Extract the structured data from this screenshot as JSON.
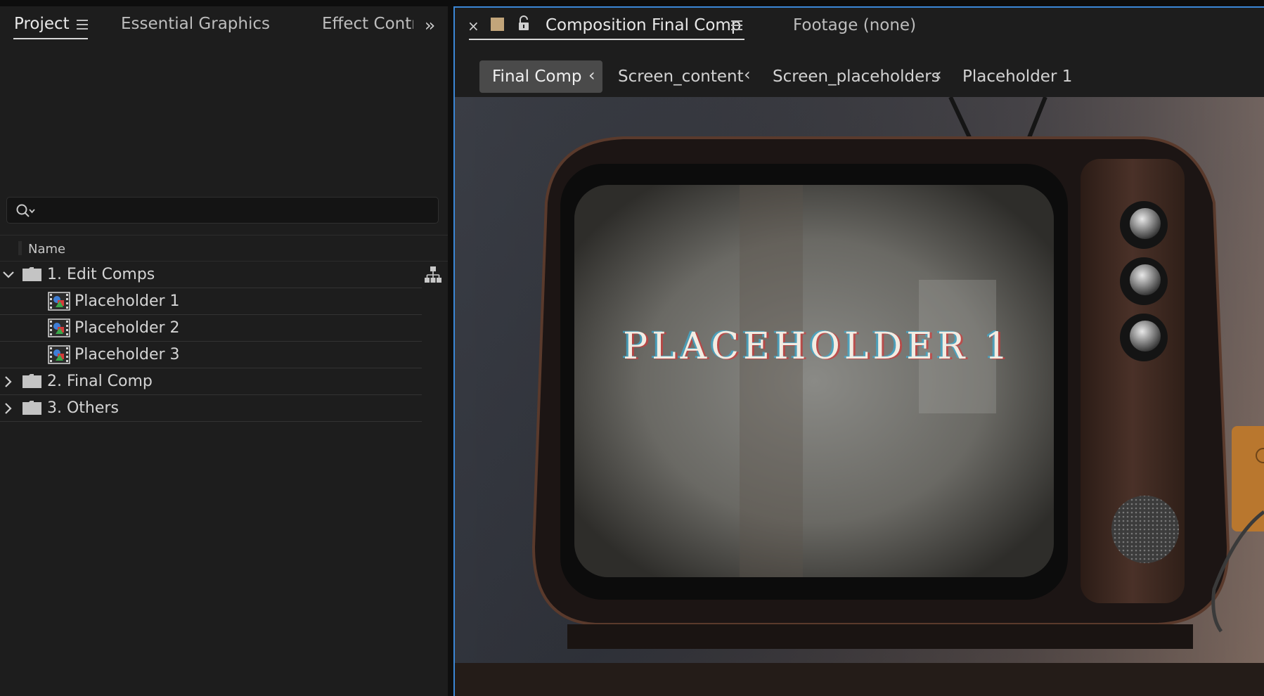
{
  "left_panel": {
    "tabs": [
      {
        "label": "Project"
      },
      {
        "label": "Essential Graphics"
      },
      {
        "label": "Effect Controls"
      }
    ],
    "search": {
      "placeholder": ""
    },
    "columns": {
      "name": "Name"
    },
    "tree": [
      {
        "label": "1. Edit Comps",
        "type": "folder",
        "expanded": true
      },
      {
        "label": "Placeholder 1",
        "type": "composition"
      },
      {
        "label": "Placeholder 2",
        "type": "composition"
      },
      {
        "label": "Placeholder 3",
        "type": "composition"
      },
      {
        "label": "2. Final Comp",
        "type": "folder",
        "expanded": false
      },
      {
        "label": "3. Others",
        "type": "folder",
        "expanded": false
      }
    ]
  },
  "composition_panel": {
    "tab_title": "Composition Final Comp",
    "secondary_tab": "Footage (none)",
    "label_color": "#c2a57a",
    "breadcrumbs": [
      {
        "label": "Final Comp"
      },
      {
        "label": "Screen_content"
      },
      {
        "label": "Screen_placeholders"
      },
      {
        "label": "Placeholder 1"
      }
    ],
    "viewer": {
      "screen_text": "PLACEHOLDER 1"
    }
  },
  "colors": {
    "panel_bg": "#1d1d1d",
    "focus_border": "#3b87d6",
    "active_crumb_bg": "#4a4a4a"
  }
}
